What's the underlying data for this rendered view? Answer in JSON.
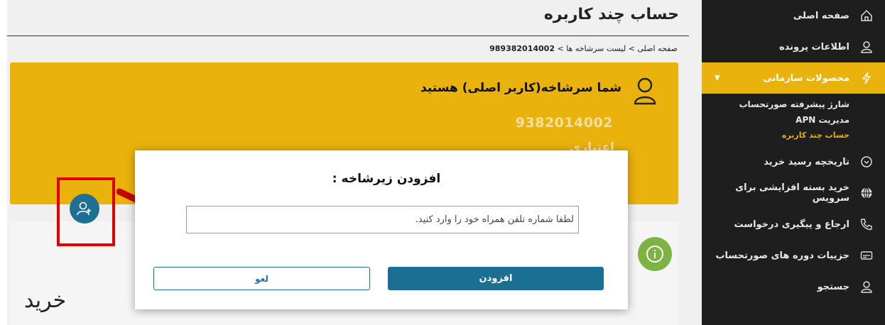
{
  "page": {
    "title": "حساب چند کاربره"
  },
  "breadcrumb": {
    "path": "صفحه اصلی > لیست سرشاخه ها > ",
    "current": "989382014002"
  },
  "sidebar": {
    "items": [
      {
        "label": "صفحه اصلی",
        "icon": "home-icon"
      },
      {
        "label": "اطلاعات پرونده",
        "icon": "user-icon"
      },
      {
        "label": "محصولات سازمانی",
        "icon": "bolt-icon",
        "active": true
      },
      {
        "label": "تاریخچه رسید خرید",
        "icon": "clock-icon"
      },
      {
        "label": "خرید بسته افزایشی برای سرویس",
        "icon": "globe-icon"
      },
      {
        "label": "ارجاع و پیگیری درخواست",
        "icon": "phone-icon"
      },
      {
        "label": "جزییات دوره های صورتحساب",
        "icon": "card-icon"
      },
      {
        "label": "جستجو",
        "icon": "user-icon"
      }
    ],
    "subitems": [
      {
        "label": "شارژ پیشرفته صورتحساب"
      },
      {
        "label": "مدیریت APN"
      },
      {
        "label": "حساب چند کاربره",
        "current": true
      }
    ],
    "accent": "#e9b20d"
  },
  "head_card": {
    "heading": "شما سرشاخه(کاربر اصلی) هستید",
    "phone": "9382014002",
    "credit_partial": "اعتباری"
  },
  "buy_section": {
    "title": "خرید"
  },
  "modal": {
    "title": "افزودن زیرشاخه :",
    "input_placeholder": "لطفا شماره تلفن همراه خود را وارد کنید.",
    "add_label": "افزودن",
    "cancel_label": "لغو"
  },
  "colors": {
    "primary": "#1b6f93",
    "accent": "#e9b20d",
    "info": "#7cb342",
    "highlight": "#e00000"
  }
}
